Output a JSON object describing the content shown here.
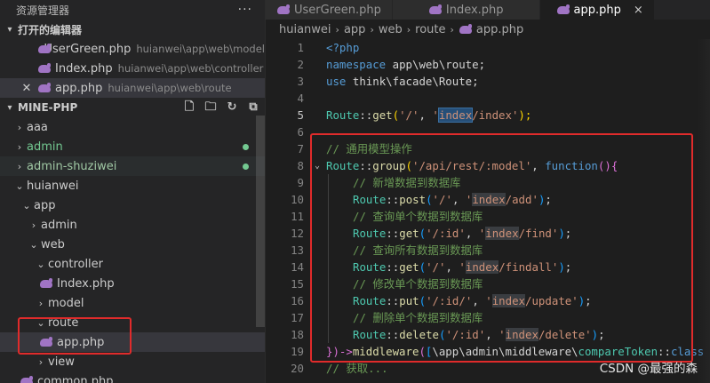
{
  "sidebar": {
    "title": "资源管理器",
    "more": "···",
    "open_editors": {
      "label": "打开的编辑器",
      "items": [
        {
          "name": "UserGreen.php",
          "path": "huianwei\\app\\web\\model"
        },
        {
          "name": "Index.php",
          "path": "huianwei\\app\\web\\controller"
        },
        {
          "name": "app.php",
          "path": "huianwei\\app\\web\\route"
        }
      ]
    },
    "project": {
      "label": "MINE-PHP",
      "tree": [
        {
          "label": "aaa"
        },
        {
          "label": "admin"
        },
        {
          "label": "admin-shuziwei"
        },
        {
          "label": "huianwei"
        },
        {
          "label": "app"
        },
        {
          "label": "admin"
        },
        {
          "label": "web"
        },
        {
          "label": "controller"
        },
        {
          "label": "Index.php"
        },
        {
          "label": "model"
        },
        {
          "label": "route"
        },
        {
          "label": "app.php"
        },
        {
          "label": "view"
        },
        {
          "label": "common.php"
        }
      ]
    }
  },
  "tabs": [
    {
      "label": "UserGreen.php"
    },
    {
      "label": "Index.php"
    },
    {
      "label": "app.php",
      "close": "×"
    }
  ],
  "breadcrumb": [
    "huianwei",
    "app",
    "web",
    "route",
    "app.php"
  ],
  "code": {
    "line_numbers": [
      "1",
      "2",
      "3",
      "4",
      "5",
      "6",
      "7",
      "8",
      "9",
      "10",
      "11",
      "12",
      "13",
      "14",
      "15",
      "16",
      "17",
      "18",
      "19",
      "20"
    ],
    "l1": "<?php",
    "l2": {
      "kw": "namespace",
      "ns": "app\\web\\route",
      "semi": ";"
    },
    "l3": {
      "kw": "use",
      "ns": "think\\facade\\Route",
      "semi": ";"
    },
    "l5": {
      "cls": "Route",
      "op": "::",
      "fn": "get",
      "str1": "'/'",
      "str2a": "'",
      "str2hl": "index",
      "str2b": "/index'",
      "end": ");"
    },
    "l7": "// 通用模型操作",
    "l8": {
      "cls": "Route",
      "op": "::",
      "fn": "group",
      "str": "'/api/rest/:model'",
      "kw": "function",
      "end": "{"
    },
    "l9": "// 新增数据到数据库",
    "l10": {
      "fn": "post",
      "str1": "'/'",
      "a": "'",
      "hl": "index",
      "b": "/add'"
    },
    "l11": "// 查询单个数据到数据库",
    "l12": {
      "fn": "get",
      "str1": "'/:id'",
      "a": "'",
      "hl": "index",
      "b": "/find'"
    },
    "l13": "// 查询所有数据到数据库",
    "l14": {
      "fn": "get",
      "str1": "'/'",
      "a": "'",
      "hl": "index",
      "b": "/findall'"
    },
    "l15": "// 修改单个数据到数据库",
    "l16": {
      "fn": "put",
      "str1": "'/:id/'",
      "a": "'",
      "hl": "index",
      "b": "/update'"
    },
    "l17": "// 删除单个数据到数据库",
    "l18": {
      "fn": "delete",
      "str1": "'/:id'",
      "a": "'",
      "hl": "index",
      "b": "/delete'"
    },
    "l19": {
      "a": "})->",
      "fn": "middleware",
      "ns": "\\app\\admin\\middleware\\",
      "cls": "compareToken",
      "op": "::",
      "tail": "class"
    },
    "l20": "// 获取..."
  },
  "watermark": "CSDN @最强的森",
  "colors": {
    "accent_red": "#e02b2b",
    "php_icon": "#a074c4",
    "git_added": "#73c991"
  }
}
